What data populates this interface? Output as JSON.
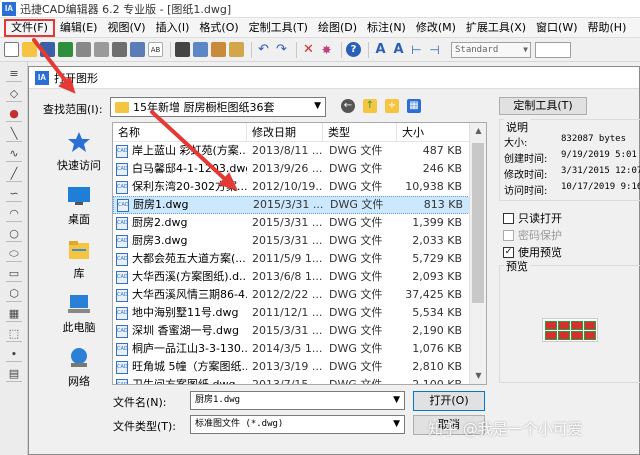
{
  "app": {
    "title": "迅捷CAD编辑器 6.2 专业版 - [图纸1.dwg]",
    "logo": "IA"
  },
  "menu": [
    "文件(F)",
    "编辑(E)",
    "视图(V)",
    "插入(I)",
    "格式(O)",
    "定制工具(T)",
    "绘图(D)",
    "标注(N)",
    "修改(M)",
    "扩展工具(X)",
    "窗口(W)",
    "帮助(H)"
  ],
  "toolbar": {
    "style_combo": "Standard"
  },
  "dialog": {
    "title": "打开图形",
    "logo": "IA",
    "lookin_label": "查找范围(I):",
    "lookin_value": "15年新增 厨房橱柜图纸36套",
    "places": [
      {
        "label": "快速访问",
        "icon": "star-icon"
      },
      {
        "label": "桌面",
        "icon": "desktop-icon"
      },
      {
        "label": "库",
        "icon": "library-icon"
      },
      {
        "label": "此电脑",
        "icon": "computer-icon"
      },
      {
        "label": "网络",
        "icon": "network-icon"
      }
    ],
    "columns": {
      "name": "名称",
      "date": "修改日期",
      "type": "类型",
      "size": "大小"
    },
    "files": [
      {
        "name": "岸上蓝山 彩虹苑(方案...",
        "date": "2013/8/11 ...",
        "type": "DWG 文件",
        "size": "487 KB"
      },
      {
        "name": "白马馨邸4-1-1203.dwg",
        "date": "2013/9/26 ...",
        "type": "DWG 文件",
        "size": "246 KB"
      },
      {
        "name": "保利东湾20-302方案...",
        "date": "2012/10/19...",
        "type": "DWG 文件",
        "size": "10,938 KB"
      },
      {
        "name": "厨房1.dwg",
        "date": "2015/3/31 ...",
        "type": "DWG 文件",
        "size": "813 KB",
        "selected": true
      },
      {
        "name": "厨房2.dwg",
        "date": "2015/3/31 ...",
        "type": "DWG 文件",
        "size": "1,399 KB"
      },
      {
        "name": "厨房3.dwg",
        "date": "2015/3/31 ...",
        "type": "DWG 文件",
        "size": "2,033 KB"
      },
      {
        "name": "大都会苑五大道方案(...",
        "date": "2011/5/9 1...",
        "type": "DWG 文件",
        "size": "5,729 KB"
      },
      {
        "name": "大华西溪(方案图纸).d...",
        "date": "2013/6/8 1...",
        "type": "DWG 文件",
        "size": "2,093 KB"
      },
      {
        "name": "大华西溪风情三期86-4...",
        "date": "2012/2/22 ...",
        "type": "DWG 文件",
        "size": "37,425 KB"
      },
      {
        "name": "地中海别墅11号.dwg",
        "date": "2011/12/1 ...",
        "type": "DWG 文件",
        "size": "5,534 KB"
      },
      {
        "name": "深圳 香蜜湖一号.dwg",
        "date": "2015/3/31 ...",
        "type": "DWG 文件",
        "size": "2,190 KB"
      },
      {
        "name": "桐庐一品江山3-3-130...",
        "date": "2014/3/5 1...",
        "type": "DWG 文件",
        "size": "1,076 KB"
      },
      {
        "name": "旺角城 5幢（方案图纸...",
        "date": "2013/3/19 ...",
        "type": "DWG 文件",
        "size": "2,810 KB"
      },
      {
        "name": "卫生间方案图纸.dwg",
        "date": "2013/7/15 ...",
        "type": "DWG 文件",
        "size": "2,100 KB"
      }
    ],
    "filename_label": "文件名(N):",
    "filename_value": "厨房1.dwg",
    "filetype_label": "文件类型(T):",
    "filetype_value": "标准图文件 (*.dwg)",
    "open_button": "打开(O)",
    "cancel_button": "取消",
    "custom_tools_button": "定制工具(T)",
    "info": {
      "legend": "说明",
      "rows": [
        {
          "label": "大小:",
          "value": "832087 bytes"
        },
        {
          "label": "创建时间:",
          "value": "9/19/2019 5:01 P"
        },
        {
          "label": "修改时间:",
          "value": "3/31/2015 12:07"
        },
        {
          "label": "访问时间:",
          "value": "10/17/2019 9:16"
        }
      ]
    },
    "readonly_label": "只读打开",
    "password_label": "密码保护",
    "preview_check_label": "使用预览",
    "preview_legend": "预览"
  },
  "watermark": "知乎 @我是一个小可爱",
  "colors": {
    "accent_red": "#e53935",
    "selection": "#cce8ff",
    "brand_blue": "#2a6fd6"
  }
}
